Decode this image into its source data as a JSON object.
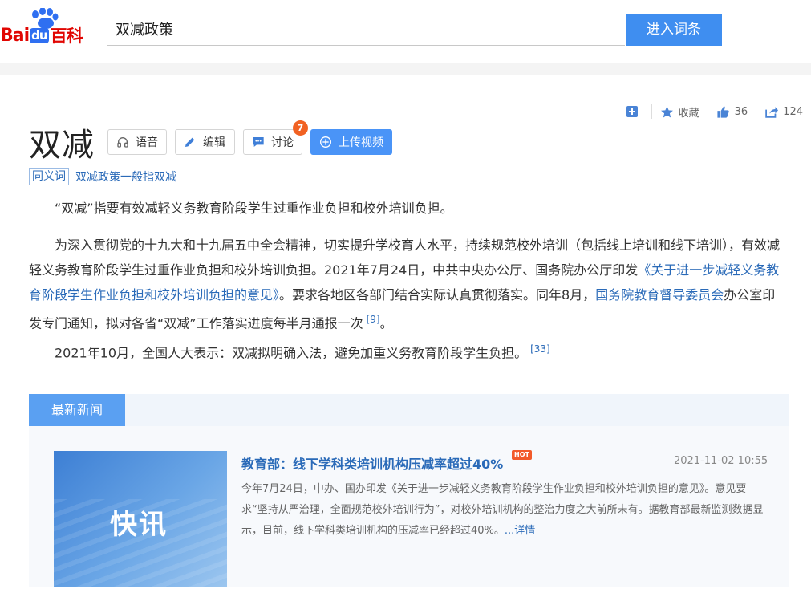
{
  "header": {
    "logo_bai": "Bai",
    "logo_du": "du",
    "logo_baike": "百科",
    "search_value": "双减政策",
    "go_button": "进入词条"
  },
  "actions": {
    "collect_label": "收藏",
    "like_count": "36",
    "share_count": "124"
  },
  "entry": {
    "title": "双减",
    "tools": {
      "voice": "语音",
      "edit": "编辑",
      "discuss": "讨论",
      "discuss_badge": "7",
      "upload": "上传视频"
    },
    "synonym_tag": "同义词",
    "synonym_link": "双减政策",
    "synonym_suffix": "一般指双减"
  },
  "paragraphs": {
    "p1": "“双减”指要有效减轻义务教育阶段学生过重作业负担和校外培训负担。",
    "p2_a": "为深入贯彻党的十九大和十九届五中全会精神，切实提升学校育人水平，持续规范校外培训（包括线上培训和线下培训），有效减轻义务教育阶段学生过重作业负担和校外培训负担。2021年7月24日，中共中央办公厅、国务院办公厅印发",
    "p2_link1": "《关于进一步减轻义务教育阶段学生作业负担和校外培训负担的意见》",
    "p2_b": "。要求各地区各部门结合实际认真贯彻落实。同年8月，",
    "p2_link2": "国务院教育督导委员会",
    "p2_c": "办公室印发专门通知，拟对各省“双减”工作落实进度每半月通报一次",
    "p2_ref": "[9]",
    "p2_end": "。",
    "p3": "2021年10月，全国人大表示：双减拟明确入法，避免加重义务教育阶段学生负担。",
    "p3_ref": "[33]"
  },
  "news": {
    "tab_label": "最新新闻",
    "thumb_text": "快讯",
    "title": "教育部：线下学科类培训机构压减率超过40%",
    "hot_label": "HOT",
    "date": "2021-11-02 10:55",
    "desc": "今年7月24日，中办、国办印发《关于进一步减轻义务教育阶段学生作业负担和校外培训负担的意见》。意见要求“坚持从严治理，全面规范校外培训行为”，对校外培训机构的整治力度之大前所未有。据教育部最新监测数据显示，目前，线下学科类培训机构的压减率已经超过40%。",
    "more": "...详情"
  },
  "colors": {
    "link": "#2a6ab8",
    "button_blue": "#3f8ef0",
    "badge_orange": "#f16122"
  }
}
